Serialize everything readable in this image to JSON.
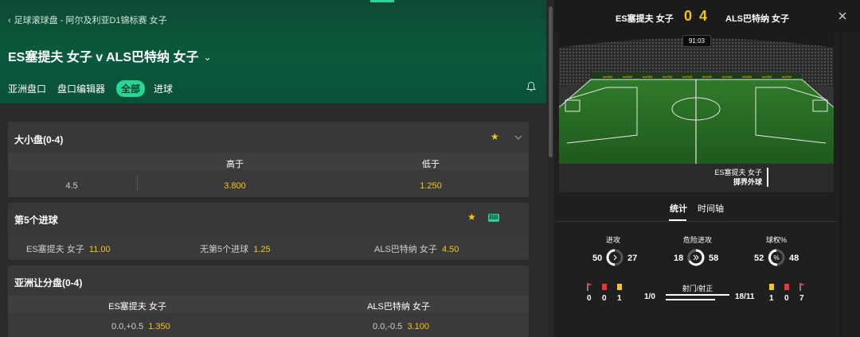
{
  "breadcrumb": "足球滚球盘 - 阿尔及利亚D1锦标赛 女子",
  "match_title": "ES塞提夫 女子 v ALS巴特纳 女子",
  "tabs": [
    {
      "label": "亚洲盘口",
      "active": false
    },
    {
      "label": "盘口编辑器",
      "active": false
    },
    {
      "label": "全部",
      "active": true
    },
    {
      "label": "进球",
      "active": false
    }
  ],
  "markets": {
    "total": {
      "title": "大小盘(0-4)",
      "col_over": "高于",
      "col_under": "低于",
      "line": "4.5",
      "over": "3.800",
      "under": "1.250"
    },
    "fifth_goal": {
      "title": "第5个进球",
      "badge": "BB",
      "home_label": "ES塞提夫 女子",
      "home_odds": "11.00",
      "none_label": "无第5个进球",
      "none_odds": "1.25",
      "away_label": "ALS巴特纳 女子",
      "away_odds": "4.50"
    },
    "asian_handicap": {
      "title": "亚洲让分盘(0-4)",
      "home_col": "ES塞提夫 女子",
      "away_col": "ALS巴特纳 女子",
      "home_line": "0.0,+0.5",
      "home_odds": "1.350",
      "away_line": "0.0,-0.5",
      "away_odds": "3.100"
    }
  },
  "scoreboard": {
    "home": "ES塞提夫 女子",
    "away": "ALS巴特纳 女子",
    "home_score": "0",
    "away_score": "4",
    "clock": "91:03",
    "event_team": "ES塞提夫 女子",
    "event_text": "掷界外球"
  },
  "stats_tabs": [
    {
      "label": "统计",
      "active": true
    },
    {
      "label": "时间轴",
      "active": false
    }
  ],
  "stats": {
    "attacks": {
      "label": "进攻",
      "home": "50",
      "away": "27"
    },
    "dangerous": {
      "label": "危险进攻",
      "home": "18",
      "away": "58"
    },
    "possession": {
      "label": "球权%",
      "home": "52",
      "away": "48"
    },
    "shots": {
      "label": "射门/射正",
      "home": "1/0",
      "away": "18/11"
    },
    "home_corners": "0",
    "home_red": "0",
    "home_yellow": "1",
    "away_yellow": "1",
    "away_red": "0",
    "away_corners": "7"
  },
  "colors": {
    "accent": "#25d69a",
    "odds": "#f5c518",
    "header_green": "#0a5a3b"
  }
}
